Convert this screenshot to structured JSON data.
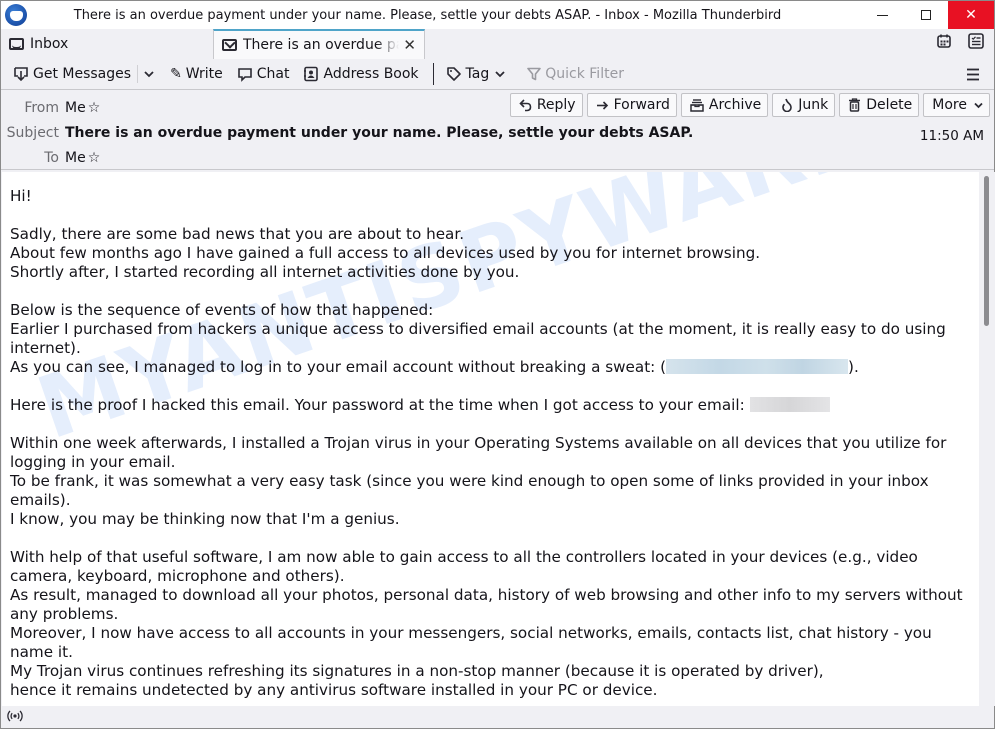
{
  "window": {
    "title": "There is an overdue payment under your name. Please, settle your debts ASAP. - Inbox - Mozilla Thunderbird",
    "controls": {
      "minimize": "minimize",
      "maximize": "maximize",
      "close": "✕"
    }
  },
  "tabs": [
    {
      "label": "Inbox",
      "icon": "inbox-icon",
      "active": false
    },
    {
      "label": "There is an overdue payment under your name. Please, settle your debts ASAP.",
      "icon": "envelope-icon",
      "active": true,
      "close": "✕"
    }
  ],
  "toolbar": {
    "get_messages": "Get Messages",
    "write": "Write",
    "chat": "Chat",
    "address_book": "Address Book",
    "tag": "Tag",
    "quick_filter": "Quick Filter"
  },
  "header": {
    "from_label": "From",
    "from_value": "Me",
    "subject_label": "Subject",
    "subject_value": "There is an overdue payment under your name. Please, settle your debts ASAP.",
    "to_label": "To",
    "to_value": "Me",
    "time": "11:50 AM",
    "actions": {
      "reply": "Reply",
      "forward": "Forward",
      "archive": "Archive",
      "junk": "Junk",
      "delete": "Delete",
      "more": "More"
    }
  },
  "body": {
    "greeting": "Hi!",
    "p1": "Sadly, there are some bad news that you are about to hear.\nAbout few months ago I have gained a full access to all devices used by you for internet browsing.\nShortly after, I started recording all internet activities done by you.",
    "p2a": "Below is the sequence of events of how that happened:\nEarlier I purchased from hackers a unique access to diversified email accounts (at the moment, it is really easy to do using internet).\nAs you can see, I managed to log in to your email account without breaking a sweat: (",
    "p2b": ").",
    "p3": "Here is the proof I hacked this email. Your password at the time when I got access to your email: ",
    "p4": "Within one week afterwards, I installed a Trojan virus in your Operating Systems available on all devices that you utilize for logging in your email.\nTo be frank, it was somewhat a very easy task (since you were kind enough to open some of links provided in your inbox emails).\nI know, you may be thinking now that I'm a genius.",
    "p5": "With help of that useful software, I am now able to gain access to all the controllers located in your devices (e.g., video camera, keyboard, microphone and others).\nAs result, managed to download all your photos, personal data, history of web browsing and other info to my servers without any problems.\nMoreover, I now have access to all accounts in your messengers, social networks, emails, contacts list, chat history - you name it.\nMy Trojan virus continues refreshing its signatures in a non-stop manner (because it is operated by driver),\nhence it remains undetected by any antivirus software installed in your PC or device."
  },
  "watermark": "MYANTISPYWARE.COM",
  "statusbar": {
    "icon": "online-status-icon"
  }
}
